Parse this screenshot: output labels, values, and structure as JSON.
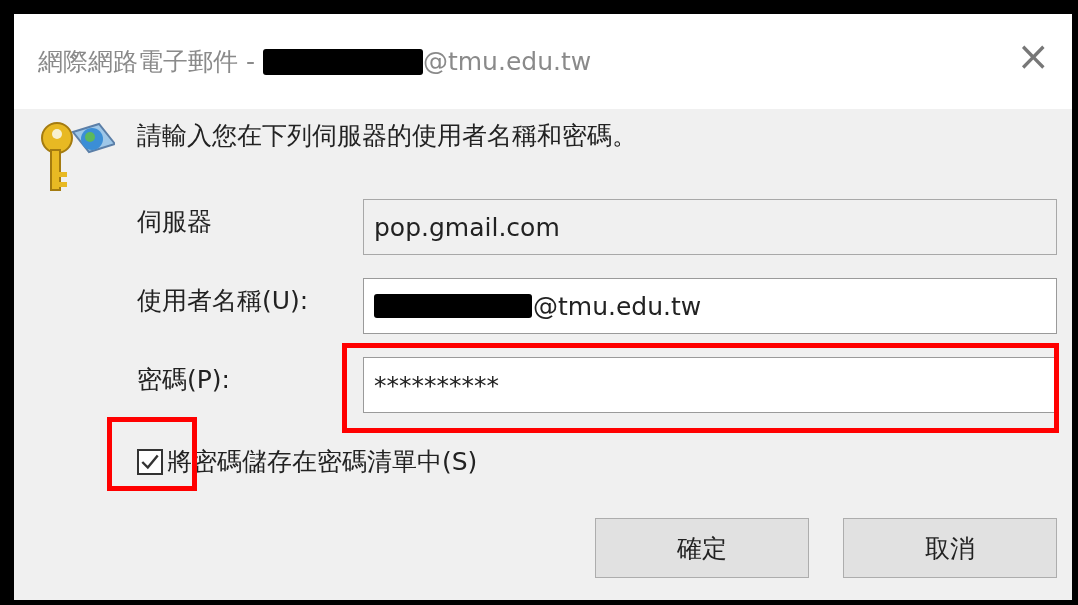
{
  "window": {
    "title_prefix": "網際網路電子郵件 -",
    "title_redacted": true,
    "title_suffix": "@tmu.edu.tw",
    "close": "×"
  },
  "prompt": "請輸入您在下列伺服器的使用者名稱和密碼。",
  "fields": [
    {
      "label": "伺服器",
      "value": "pop.gmail.com",
      "readonly": true,
      "redacted": false,
      "highlighted": false
    },
    {
      "label": "使用者名稱(U):",
      "value": "@tmu.edu.tw",
      "readonly": false,
      "redacted": true,
      "highlighted": false
    },
    {
      "label": "密碼(P):",
      "value": "**********",
      "readonly": false,
      "redacted": false,
      "highlighted": true
    }
  ],
  "save_password": {
    "label": "將密碼儲存在密碼清單中(S)",
    "checked": true,
    "highlighted": true
  },
  "buttons": [
    "確定",
    "取消"
  ]
}
